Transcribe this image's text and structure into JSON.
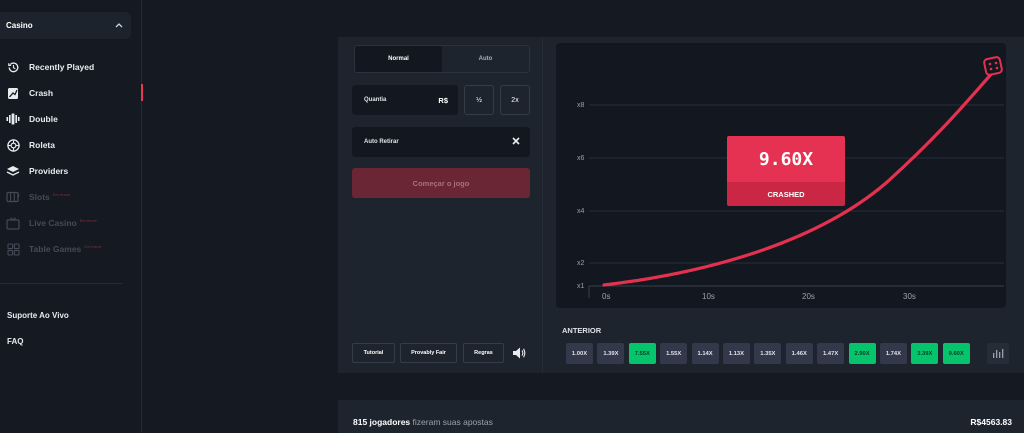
{
  "sidebar": {
    "casino_label": "Casino",
    "items": [
      {
        "label": "Recently Played",
        "icon": "history-icon"
      },
      {
        "label": "Crash",
        "icon": "crash-icon"
      },
      {
        "label": "Double",
        "icon": "double-icon"
      },
      {
        "label": "Roleta",
        "icon": "roulette-icon"
      },
      {
        "label": "Providers",
        "icon": "providers-icon"
      },
      {
        "label": "Slots",
        "icon": "slots-icon",
        "soon": "Em breve"
      },
      {
        "label": "Live Casino",
        "icon": "live-casino-icon",
        "soon": "Em breve"
      },
      {
        "label": "Table Games",
        "icon": "table-games-icon",
        "soon": "Em breve"
      }
    ],
    "support": "Suporte Ao Vivo",
    "faq": "FAQ"
  },
  "controls": {
    "mode_normal": "Normal",
    "mode_auto": "Auto",
    "quantity_label": "Quantia",
    "currency": "R$",
    "half": "½",
    "double": "2x",
    "auto_withdraw_label": "Auto Retirar",
    "start_button": "Começar o jogo",
    "tutorial": "Tutorial",
    "provably_fair": "Provably Fair",
    "rules": "Regras"
  },
  "game": {
    "multiplier": "9.60X",
    "status": "CRASHED",
    "y_ticks": [
      "x8",
      "x6",
      "x4",
      "x2",
      "x1"
    ],
    "x_ticks": [
      "0s",
      "10s",
      "20s",
      "30s"
    ],
    "curve_color": "#e4314f"
  },
  "history": {
    "label": "ANTERIOR",
    "values": [
      {
        "v": "1.00X",
        "win": false
      },
      {
        "v": "1.39X",
        "win": false
      },
      {
        "v": "7.55X",
        "win": true
      },
      {
        "v": "1.55X",
        "win": false
      },
      {
        "v": "1.14X",
        "win": false
      },
      {
        "v": "1.13X",
        "win": false
      },
      {
        "v": "1.35X",
        "win": false
      },
      {
        "v": "1.46X",
        "win": false
      },
      {
        "v": "1.47X",
        "win": false
      },
      {
        "v": "2.90X",
        "win": true
      },
      {
        "v": "1.74X",
        "win": false
      },
      {
        "v": "3.39X",
        "win": true
      },
      {
        "v": "9.60X",
        "win": true
      }
    ]
  },
  "footer": {
    "players_count": "815 jogadores",
    "players_text": "fizeram suas apostas",
    "total": "R$4563.83"
  }
}
